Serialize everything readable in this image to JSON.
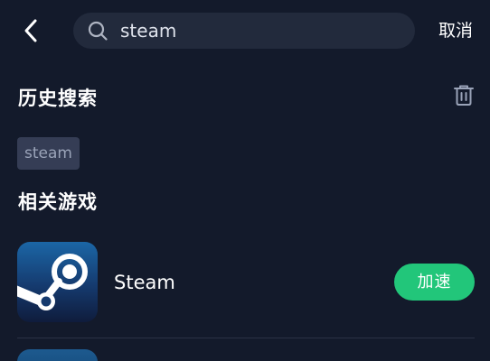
{
  "header": {
    "back_icon": "chevron-left-icon",
    "search": {
      "icon": "search-icon",
      "value": "steam",
      "placeholder": ""
    },
    "cancel_label": "取消"
  },
  "history": {
    "title": "历史搜索",
    "clear_icon": "trash-icon",
    "items": [
      "steam"
    ]
  },
  "related": {
    "title": "相关游戏",
    "games": [
      {
        "name": "Steam",
        "logo_icon": "steam-logo-icon",
        "action_label": "加速"
      }
    ]
  },
  "colors": {
    "background": "#131a2b",
    "search_bg": "#222a3c",
    "chip_bg": "#353d55",
    "accent_green": "#22c67a",
    "steam_blue_top": "#1b66a6",
    "steam_blue_bottom": "#0f1c3c"
  }
}
